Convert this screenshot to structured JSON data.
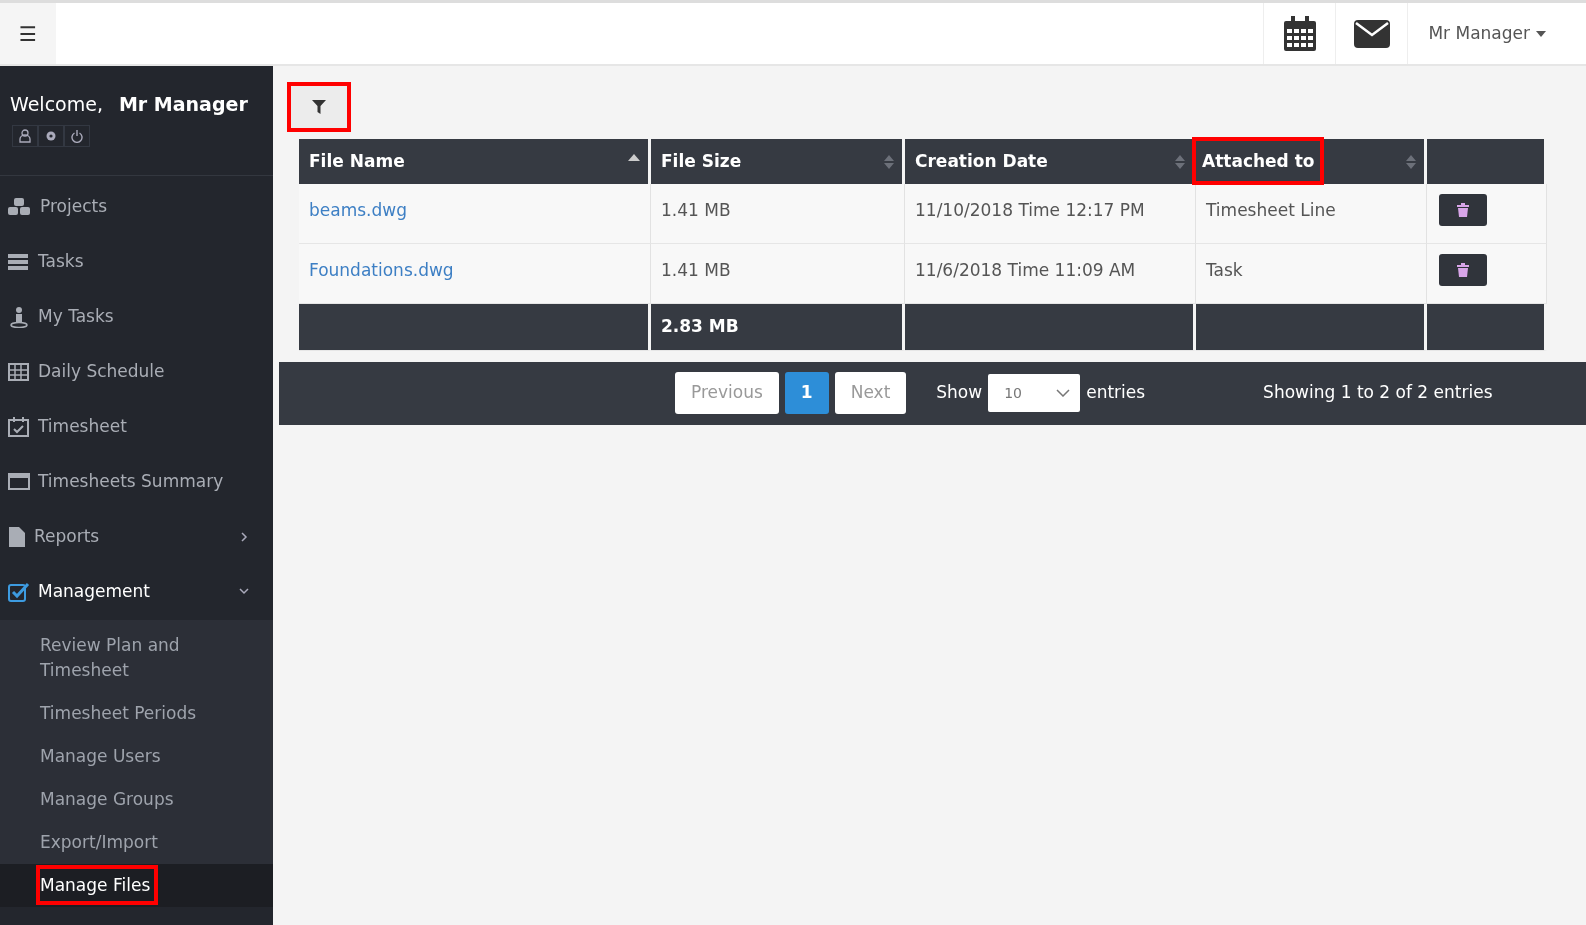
{
  "topbar": {
    "menu_toggle": "☰",
    "user": "Mr Manager"
  },
  "sidebar": {
    "welcome": "Welcome,",
    "user": "Mr Manager",
    "items": [
      {
        "label": "Projects",
        "selected": false
      },
      {
        "label": "Tasks",
        "selected": false
      },
      {
        "label": "My Tasks",
        "selected": false
      },
      {
        "label": "Daily Schedule",
        "selected": false
      },
      {
        "label": "Timesheet",
        "selected": false
      },
      {
        "label": "Timesheets Summary",
        "selected": false
      },
      {
        "label": "Reports",
        "selected": false,
        "expanded": false
      },
      {
        "label": "Management",
        "selected": true,
        "expanded": true,
        "children": [
          {
            "label": "Review Plan and Timesheet",
            "selected": false,
            "highlighted": false
          },
          {
            "label": "Timesheet Periods",
            "selected": false,
            "highlighted": false
          },
          {
            "label": "Manage Users",
            "selected": false,
            "highlighted": false
          },
          {
            "label": "Manage Groups",
            "selected": false,
            "highlighted": false
          },
          {
            "label": "Export/Import",
            "selected": false,
            "highlighted": false
          },
          {
            "label": "Manage Files",
            "selected": true,
            "highlighted": true
          }
        ]
      }
    ]
  },
  "filter_button": {
    "highlighted": true
  },
  "table": {
    "columns": [
      {
        "label": "File Name",
        "sorted": true,
        "highlighted": false
      },
      {
        "label": "File Size",
        "sorted": false,
        "highlighted": false
      },
      {
        "label": "Creation Date",
        "sorted": false,
        "highlighted": false
      },
      {
        "label": "Attached to",
        "sorted": false,
        "highlighted": true
      }
    ],
    "rows": [
      {
        "file_name": "beams.dwg",
        "file_size": "1.41 MB",
        "creation_date": "11/10/2018 Time 12:17 PM",
        "attached_to": "Timesheet Line"
      },
      {
        "file_name": "Foundations.dwg",
        "file_size": "1.41 MB",
        "creation_date": "11/6/2018 Time 11:09 AM",
        "attached_to": "Task"
      }
    ],
    "total_size": "2.83 MB"
  },
  "pagination": {
    "previous": "Previous",
    "pages": [
      {
        "label": "1",
        "selected": true
      }
    ],
    "next": "Next",
    "show": "Show",
    "page_size": "10",
    "entries": "entries",
    "info": "Showing 1 to 2 of 2 entries"
  }
}
